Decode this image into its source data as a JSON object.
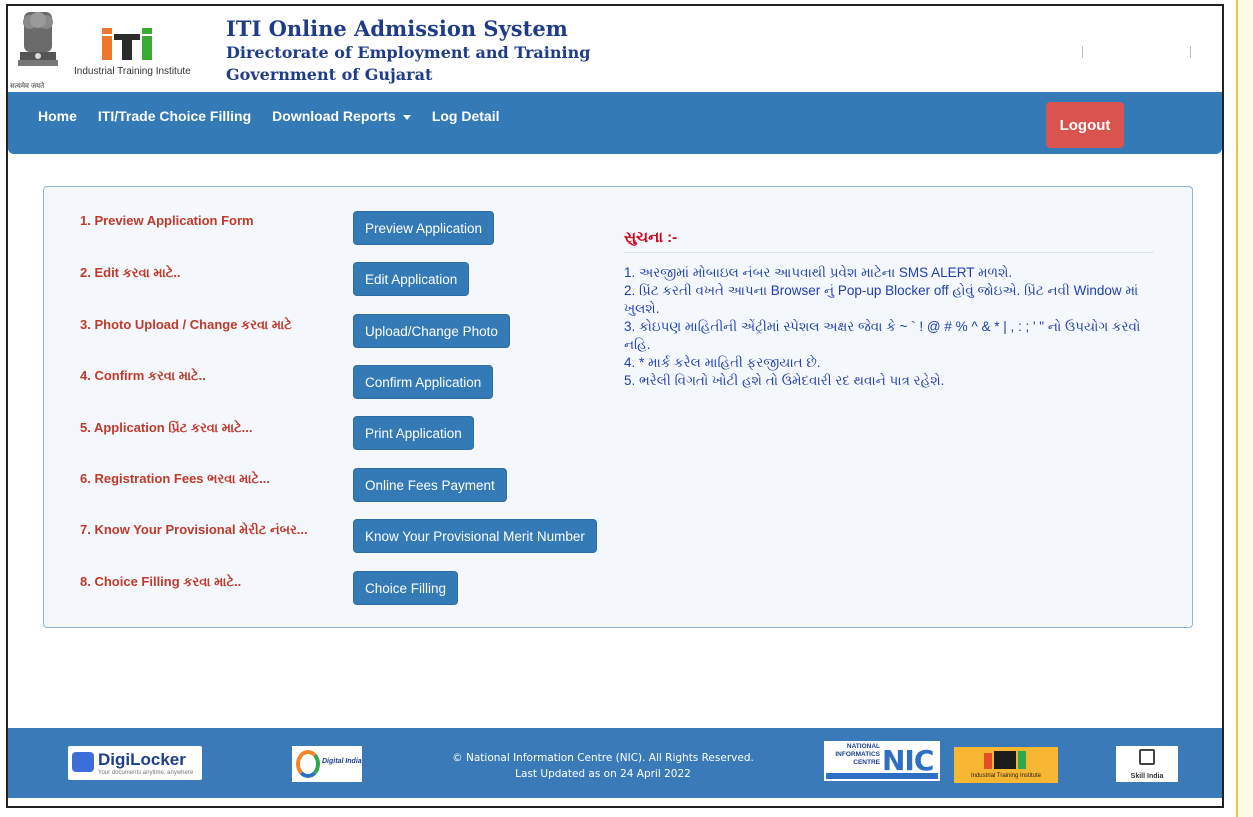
{
  "header": {
    "emblem_caption": "सत्यमेव जयते",
    "iti_caption": "Industrial Training Institute",
    "title": "ITI Online Admission System",
    "subtitle1": "Directorate of Employment and Training",
    "subtitle2": "Government of Gujarat"
  },
  "nav": {
    "items": [
      "Home",
      "ITI/Trade Choice Filling",
      "Download Reports",
      "Log Detail"
    ],
    "logout_label": "Logout",
    "bar_color": "#337ab7",
    "logout_color": "#d9534f"
  },
  "steps": [
    {
      "label": "1. Preview Application Form",
      "button": "Preview Application"
    },
    {
      "label": "2. Edit કરવા માટે..",
      "button": "Edit Application"
    },
    {
      "label": "3. Photo Upload / Change કરવા માટે",
      "button": "Upload/Change Photo"
    },
    {
      "label": "4. Confirm કરવા માટે..",
      "button": "Confirm Application"
    },
    {
      "label": "5. Application પ્રિંટ કરવા માટે...",
      "button": "Print Application"
    },
    {
      "label": "6. Registration Fees ભરવા માટે...",
      "button": "Online Fees Payment"
    },
    {
      "label": "7. Know Your Provisional મેરીટ નંબર...",
      "button": "Know Your Provisional Merit Number"
    },
    {
      "label": "8. Choice Filling કરવા માટે..",
      "button": "Choice Filling"
    }
  ],
  "notice": {
    "title": "સુચના :-",
    "lines": [
      "1. અરજીમાં મોબાઇલ નંબર આપવાથી પ્રવેશ માટેના SMS ALERT મળશે.",
      "2. પ્રિંટ કરતી વખતે આપના Browser નું Pop-up Blocker off હોવું જોઇએ. પ્રિંટ નવી Window માં ખુલશે.",
      "3. કોઇપણ માહિતીની એંટ્રીમાં સ્પેશલ અક્ષર જેવા કે ~ ` ! @ # % ^ & * | , : ; ' \" નો ઉપયોગ કરવો નહિ.",
      "4. * માર્ક કરેલ માહિતી ફરજીયાત છે.",
      "5. ભરેલી વિગતો ખોટી હશે તો ઉમેદવારી રદ થવાને પાત્ર રહેશે."
    ]
  },
  "footer": {
    "digilocker": "DigiLocker",
    "digilocker_tagline": "Your documents anytime, anywhere",
    "digital_india": "Digital India",
    "copyright": "© National Information Centre (NIC). All Rights Reserved.",
    "updated": "Last Updated as on 24 April 2022",
    "nic_small": "NATIONAL INFORMATICS CENTRE",
    "nic_big": "NIC",
    "iti_caption": "Industrial Training Institute",
    "skill_india": "Skill India"
  }
}
